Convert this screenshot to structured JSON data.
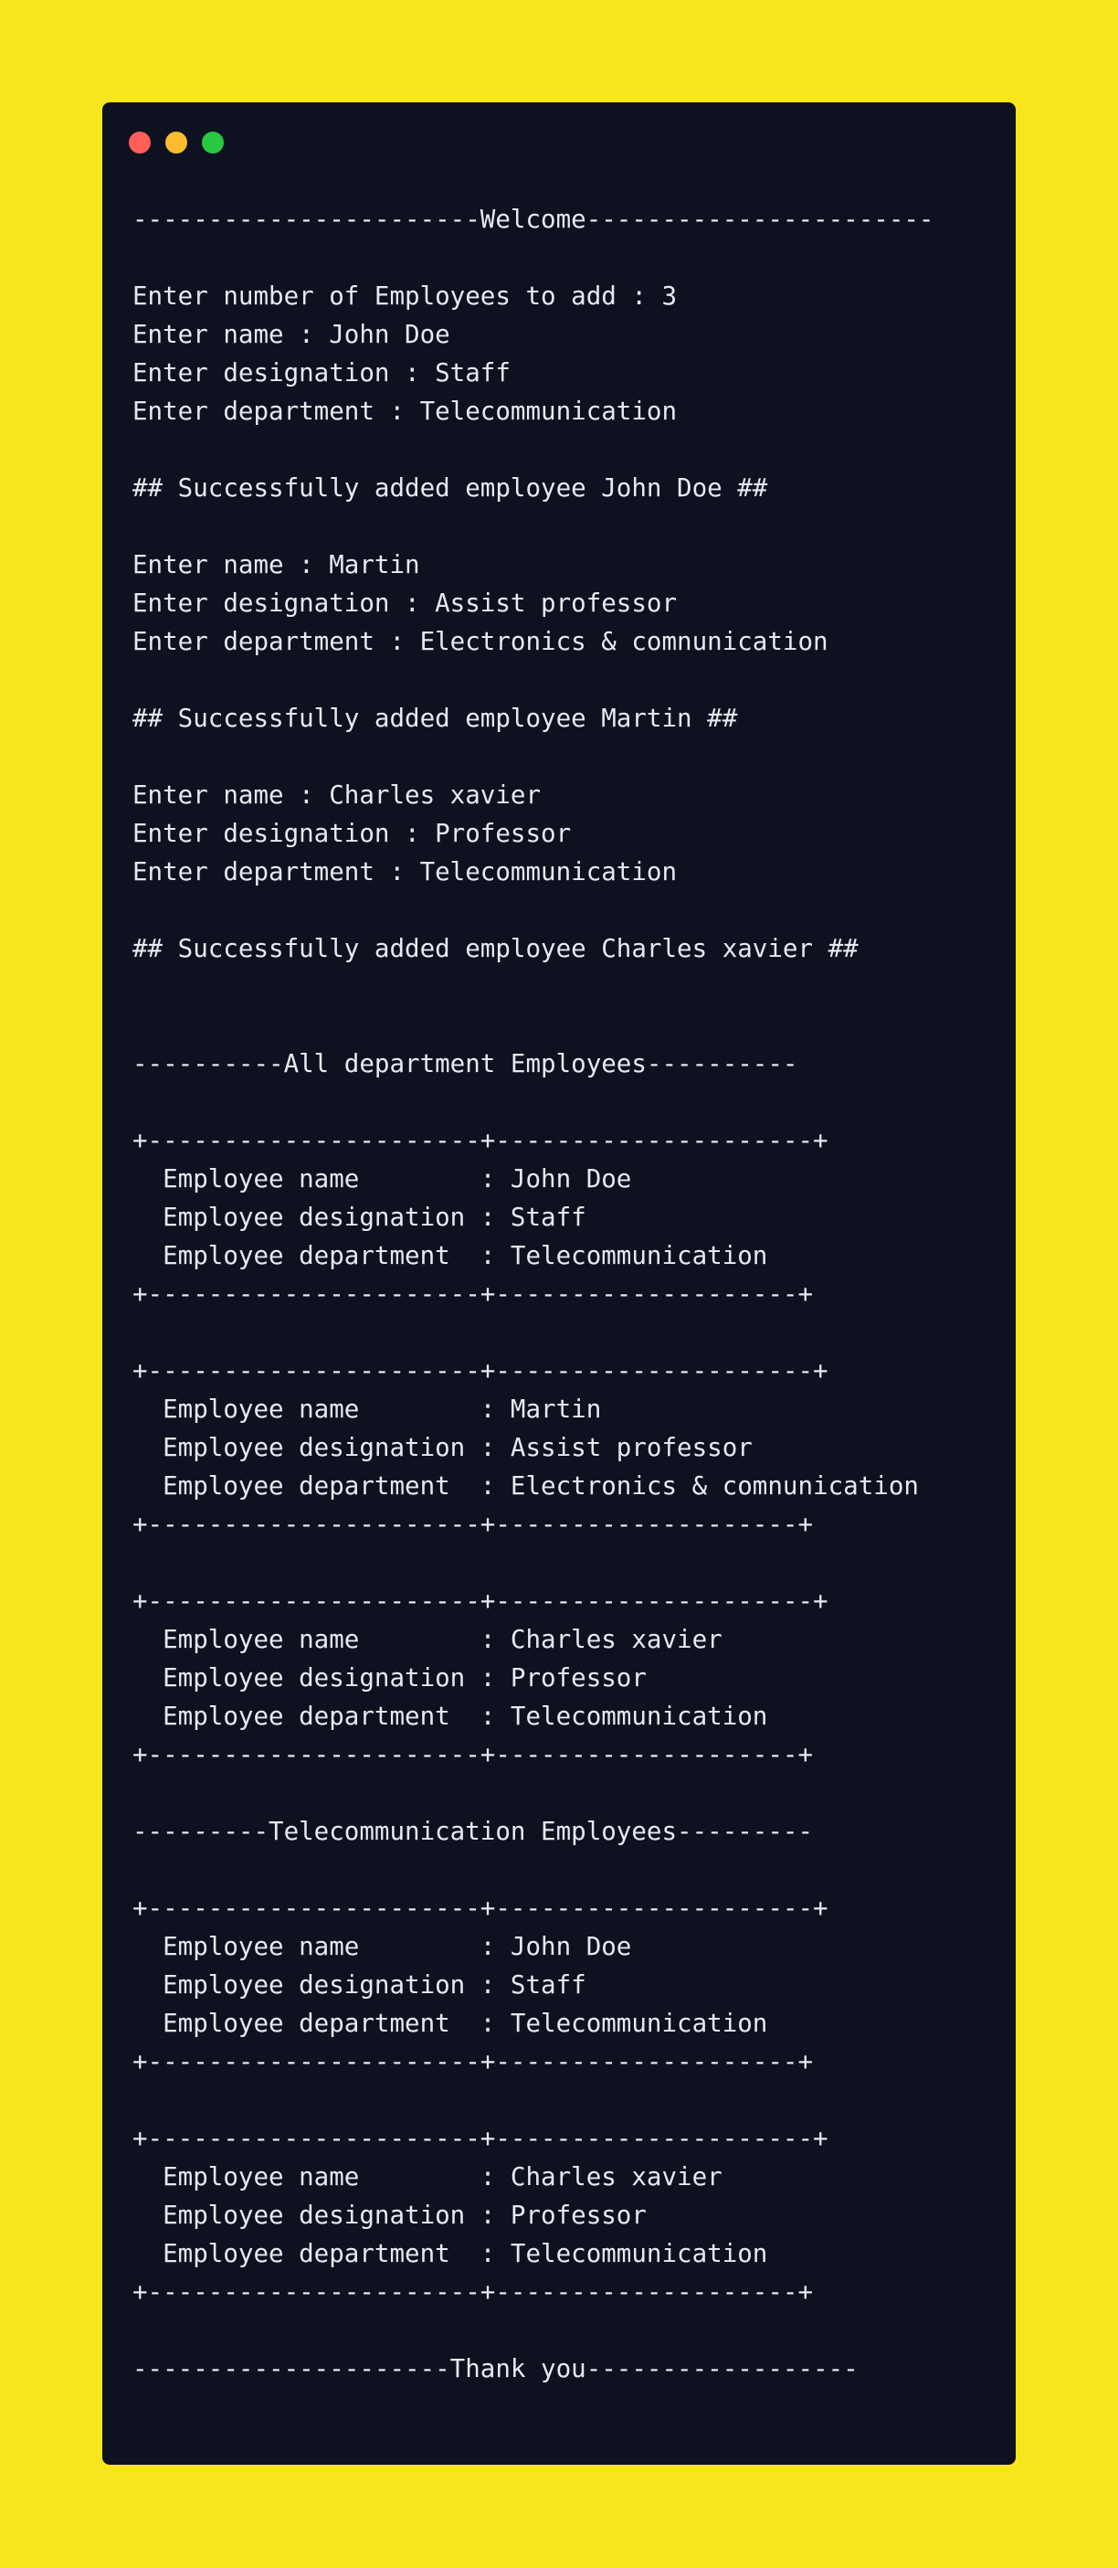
{
  "window": {
    "colors": {
      "page_background": "#f7e51e",
      "terminal_background": "#0d1120",
      "text": "#e8e9ee"
    },
    "traffic_lights": [
      {
        "name": "close",
        "color": "#ff5f57"
      },
      {
        "name": "minimize",
        "color": "#febc2e"
      },
      {
        "name": "maximize",
        "color": "#28c840"
      }
    ]
  },
  "terminal": {
    "lines": [
      "-----------------------Welcome-----------------------",
      "",
      "Enter number of Employees to add : 3",
      "Enter name : John Doe",
      "Enter designation : Staff",
      "Enter department : Telecommunication",
      "",
      "## Successfully added employee John Doe ##",
      "",
      "Enter name : Martin",
      "Enter designation : Assist professor",
      "Enter department : Electronics & comnunication",
      "",
      "## Successfully added employee Martin ##",
      "",
      "Enter name : Charles xavier",
      "Enter designation : Professor",
      "Enter department : Telecommunication",
      "",
      "## Successfully added employee Charles xavier ##",
      "",
      "",
      "----------All department Employees----------",
      "",
      "+----------------------+---------------------+",
      "  Employee name        : John Doe",
      "  Employee designation : Staff",
      "  Employee department  : Telecommunication",
      "+----------------------+--------------------+",
      "",
      "+----------------------+---------------------+",
      "  Employee name        : Martin",
      "  Employee designation : Assist professor",
      "  Employee department  : Electronics & comnunication",
      "+----------------------+--------------------+",
      "",
      "+----------------------+---------------------+",
      "  Employee name        : Charles xavier",
      "  Employee designation : Professor",
      "  Employee department  : Telecommunication",
      "+----------------------+--------------------+",
      "",
      "---------Telecommunication Employees---------",
      "",
      "+----------------------+---------------------+",
      "  Employee name        : John Doe",
      "  Employee designation : Staff",
      "  Employee department  : Telecommunication",
      "+----------------------+--------------------+",
      "",
      "+----------------------+---------------------+",
      "  Employee name        : Charles xavier",
      "  Employee designation : Professor",
      "  Employee department  : Telecommunication",
      "+----------------------+--------------------+",
      "",
      "---------------------Thank you------------------"
    ]
  }
}
